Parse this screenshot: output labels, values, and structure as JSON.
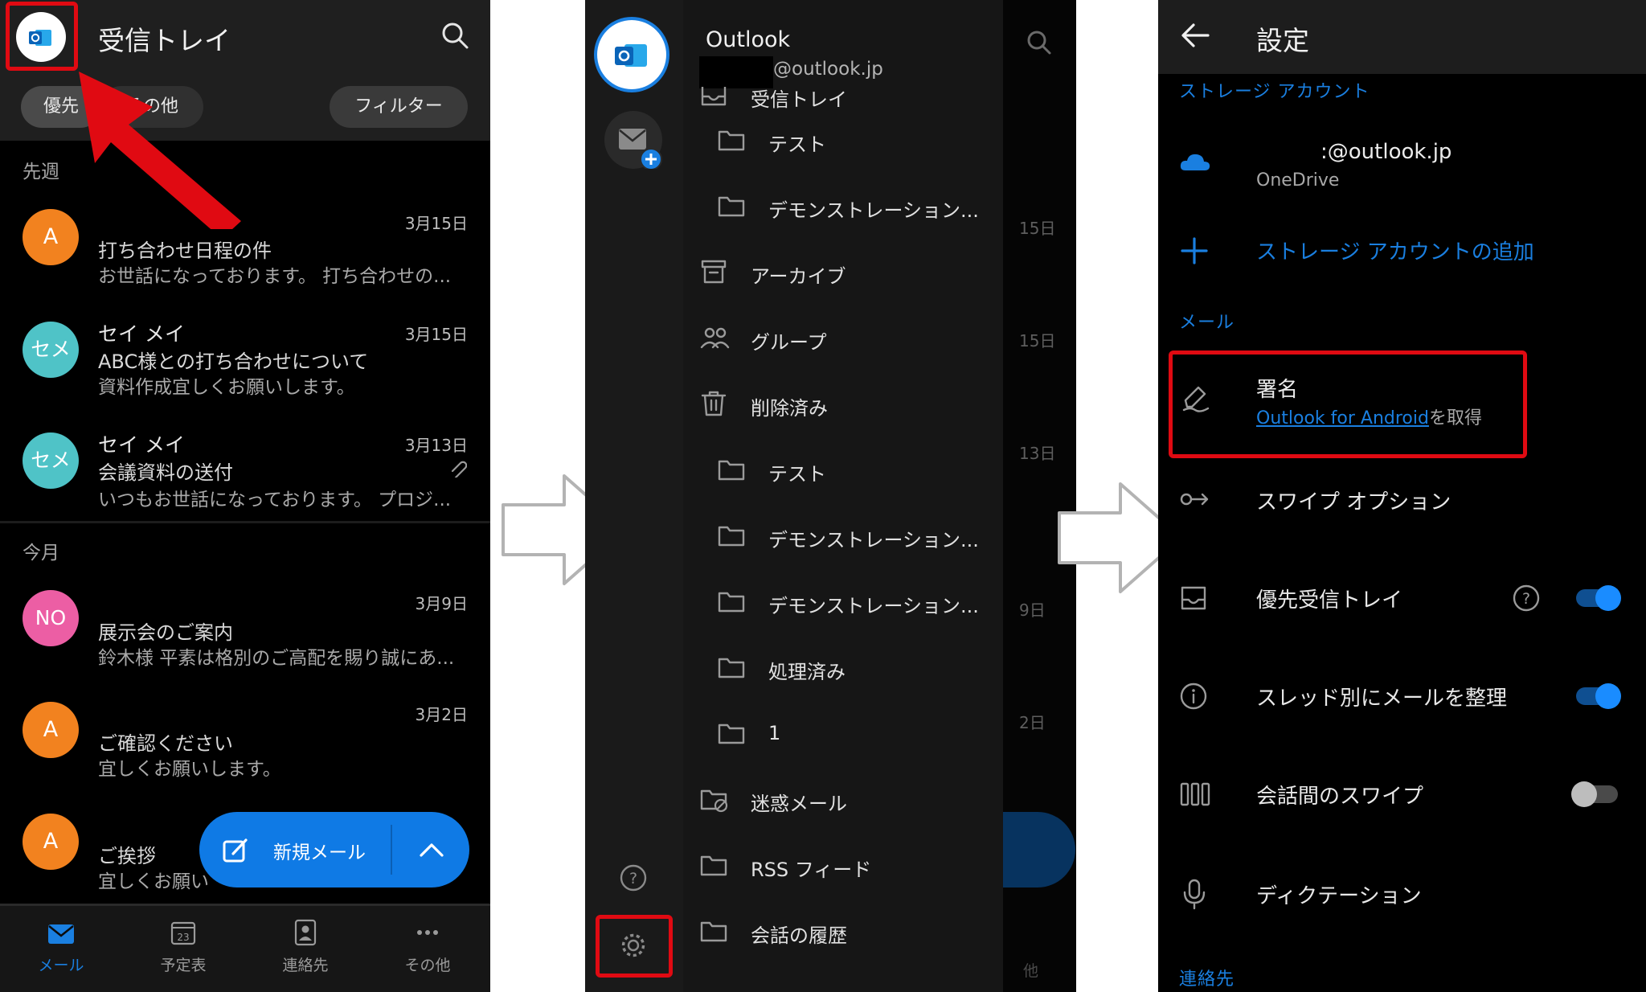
{
  "colors": {
    "accent": "#1a7fe0",
    "highlight_red": "#e00a12",
    "avatar_orange": "#f2821f",
    "avatar_teal": "#4fc3c7",
    "avatar_pink": "#ec5ea4"
  },
  "inbox": {
    "title": "受信トレイ",
    "tab_focused": "優先",
    "tab_other": "その他",
    "filter_label": "フィルター",
    "sections": {
      "last_week": "先週",
      "this_month": "今月"
    },
    "mails": [
      {
        "avatar": "A",
        "sender": "",
        "subject": "打ち合わせ日程の件",
        "preview": "お世話になっております。 打ち合わせの...",
        "date": "3月15日"
      },
      {
        "avatar": "セメ",
        "sender": "セイ メイ",
        "subject": "ABC様との打ち合わせについて",
        "preview": "資料作成宜しくお願いします。",
        "date": "3月15日"
      },
      {
        "avatar": "セメ",
        "sender": "セイ メイ",
        "subject": "会議資料の送付",
        "preview": "いつもお世話になっております。 プロジ...",
        "date": "3月13日",
        "attachment_icon": "paperclip-icon"
      },
      {
        "avatar": "NO",
        "sender": "",
        "subject": "展示会のご案内",
        "preview": "鈴木様 平素は格別のご高配を賜り誠にあ...",
        "date": "3月9日"
      },
      {
        "avatar": "A",
        "sender": "",
        "subject": "ご確認ください",
        "preview": "宜しくお願いします。",
        "date": "3月2日"
      },
      {
        "avatar": "A",
        "sender": "",
        "subject": "ご挨拶",
        "preview": "宜しくお願い",
        "date": ""
      }
    ],
    "fab": {
      "label": "新規メール"
    },
    "bottom_nav": [
      {
        "label": "メール",
        "icon": "mail-icon",
        "active": true
      },
      {
        "label": "予定表",
        "icon": "calendar-icon",
        "badge": "23"
      },
      {
        "label": "連絡先",
        "icon": "contacts-icon"
      },
      {
        "label": "その他",
        "icon": "more-icon"
      }
    ]
  },
  "drawer": {
    "app_name": "Outlook",
    "account_email": "@outlook.jp",
    "folders": [
      {
        "label": "受信トレイ",
        "icon": "inbox-icon",
        "level": 0
      },
      {
        "label": "テスト",
        "icon": "folder-icon",
        "level": 1
      },
      {
        "label": "デモンストレーション...",
        "icon": "folder-icon",
        "level": 1
      },
      {
        "label": "アーカイブ",
        "icon": "archive-icon",
        "level": 0
      },
      {
        "label": "グループ",
        "icon": "group-icon",
        "level": 0
      },
      {
        "label": "削除済み",
        "icon": "trash-icon",
        "level": 0
      },
      {
        "label": "テスト",
        "icon": "folder-icon",
        "level": 1
      },
      {
        "label": "デモンストレーション...",
        "icon": "folder-icon",
        "level": 1
      },
      {
        "label": "デモンストレーション...",
        "icon": "folder-icon",
        "level": 1
      },
      {
        "label": "処理済み",
        "icon": "folder-icon",
        "level": 1
      },
      {
        "label": "1",
        "icon": "folder-icon",
        "level": 1
      },
      {
        "label": "迷惑メール",
        "icon": "junk-icon",
        "level": 0
      },
      {
        "label": "RSS フィード",
        "icon": "folder-icon",
        "level": 0
      },
      {
        "label": "会話の履歴",
        "icon": "folder-icon",
        "level": 0
      }
    ],
    "bg_dates": [
      "15日",
      "15日",
      "13日",
      "9日",
      "2日"
    ],
    "bg_bottom_label": "他"
  },
  "settings": {
    "title": "設定",
    "storage_section": "ストレージ アカウント",
    "onedrive_email": ":@outlook.jp",
    "onedrive_label": "OneDrive",
    "add_storage": "ストレージ アカウントの追加",
    "mail_section": "メール",
    "signature_title": "署名",
    "signature_link": "Outlook for Android",
    "signature_suffix": "を取得",
    "items": [
      {
        "label": "スワイプ オプション",
        "icon": "swipe-icon"
      },
      {
        "label": "優先受信トレイ",
        "icon": "inbox-icon",
        "toggle": true,
        "help_icon": true
      },
      {
        "label": "スレッド別にメールを整理",
        "icon": "info-icon",
        "toggle": true
      },
      {
        "label": "会話間のスワイプ",
        "icon": "columns-icon",
        "toggle": false
      },
      {
        "label": "ディクテーション",
        "icon": "microphone-icon"
      }
    ],
    "contacts_section": "連絡先"
  }
}
